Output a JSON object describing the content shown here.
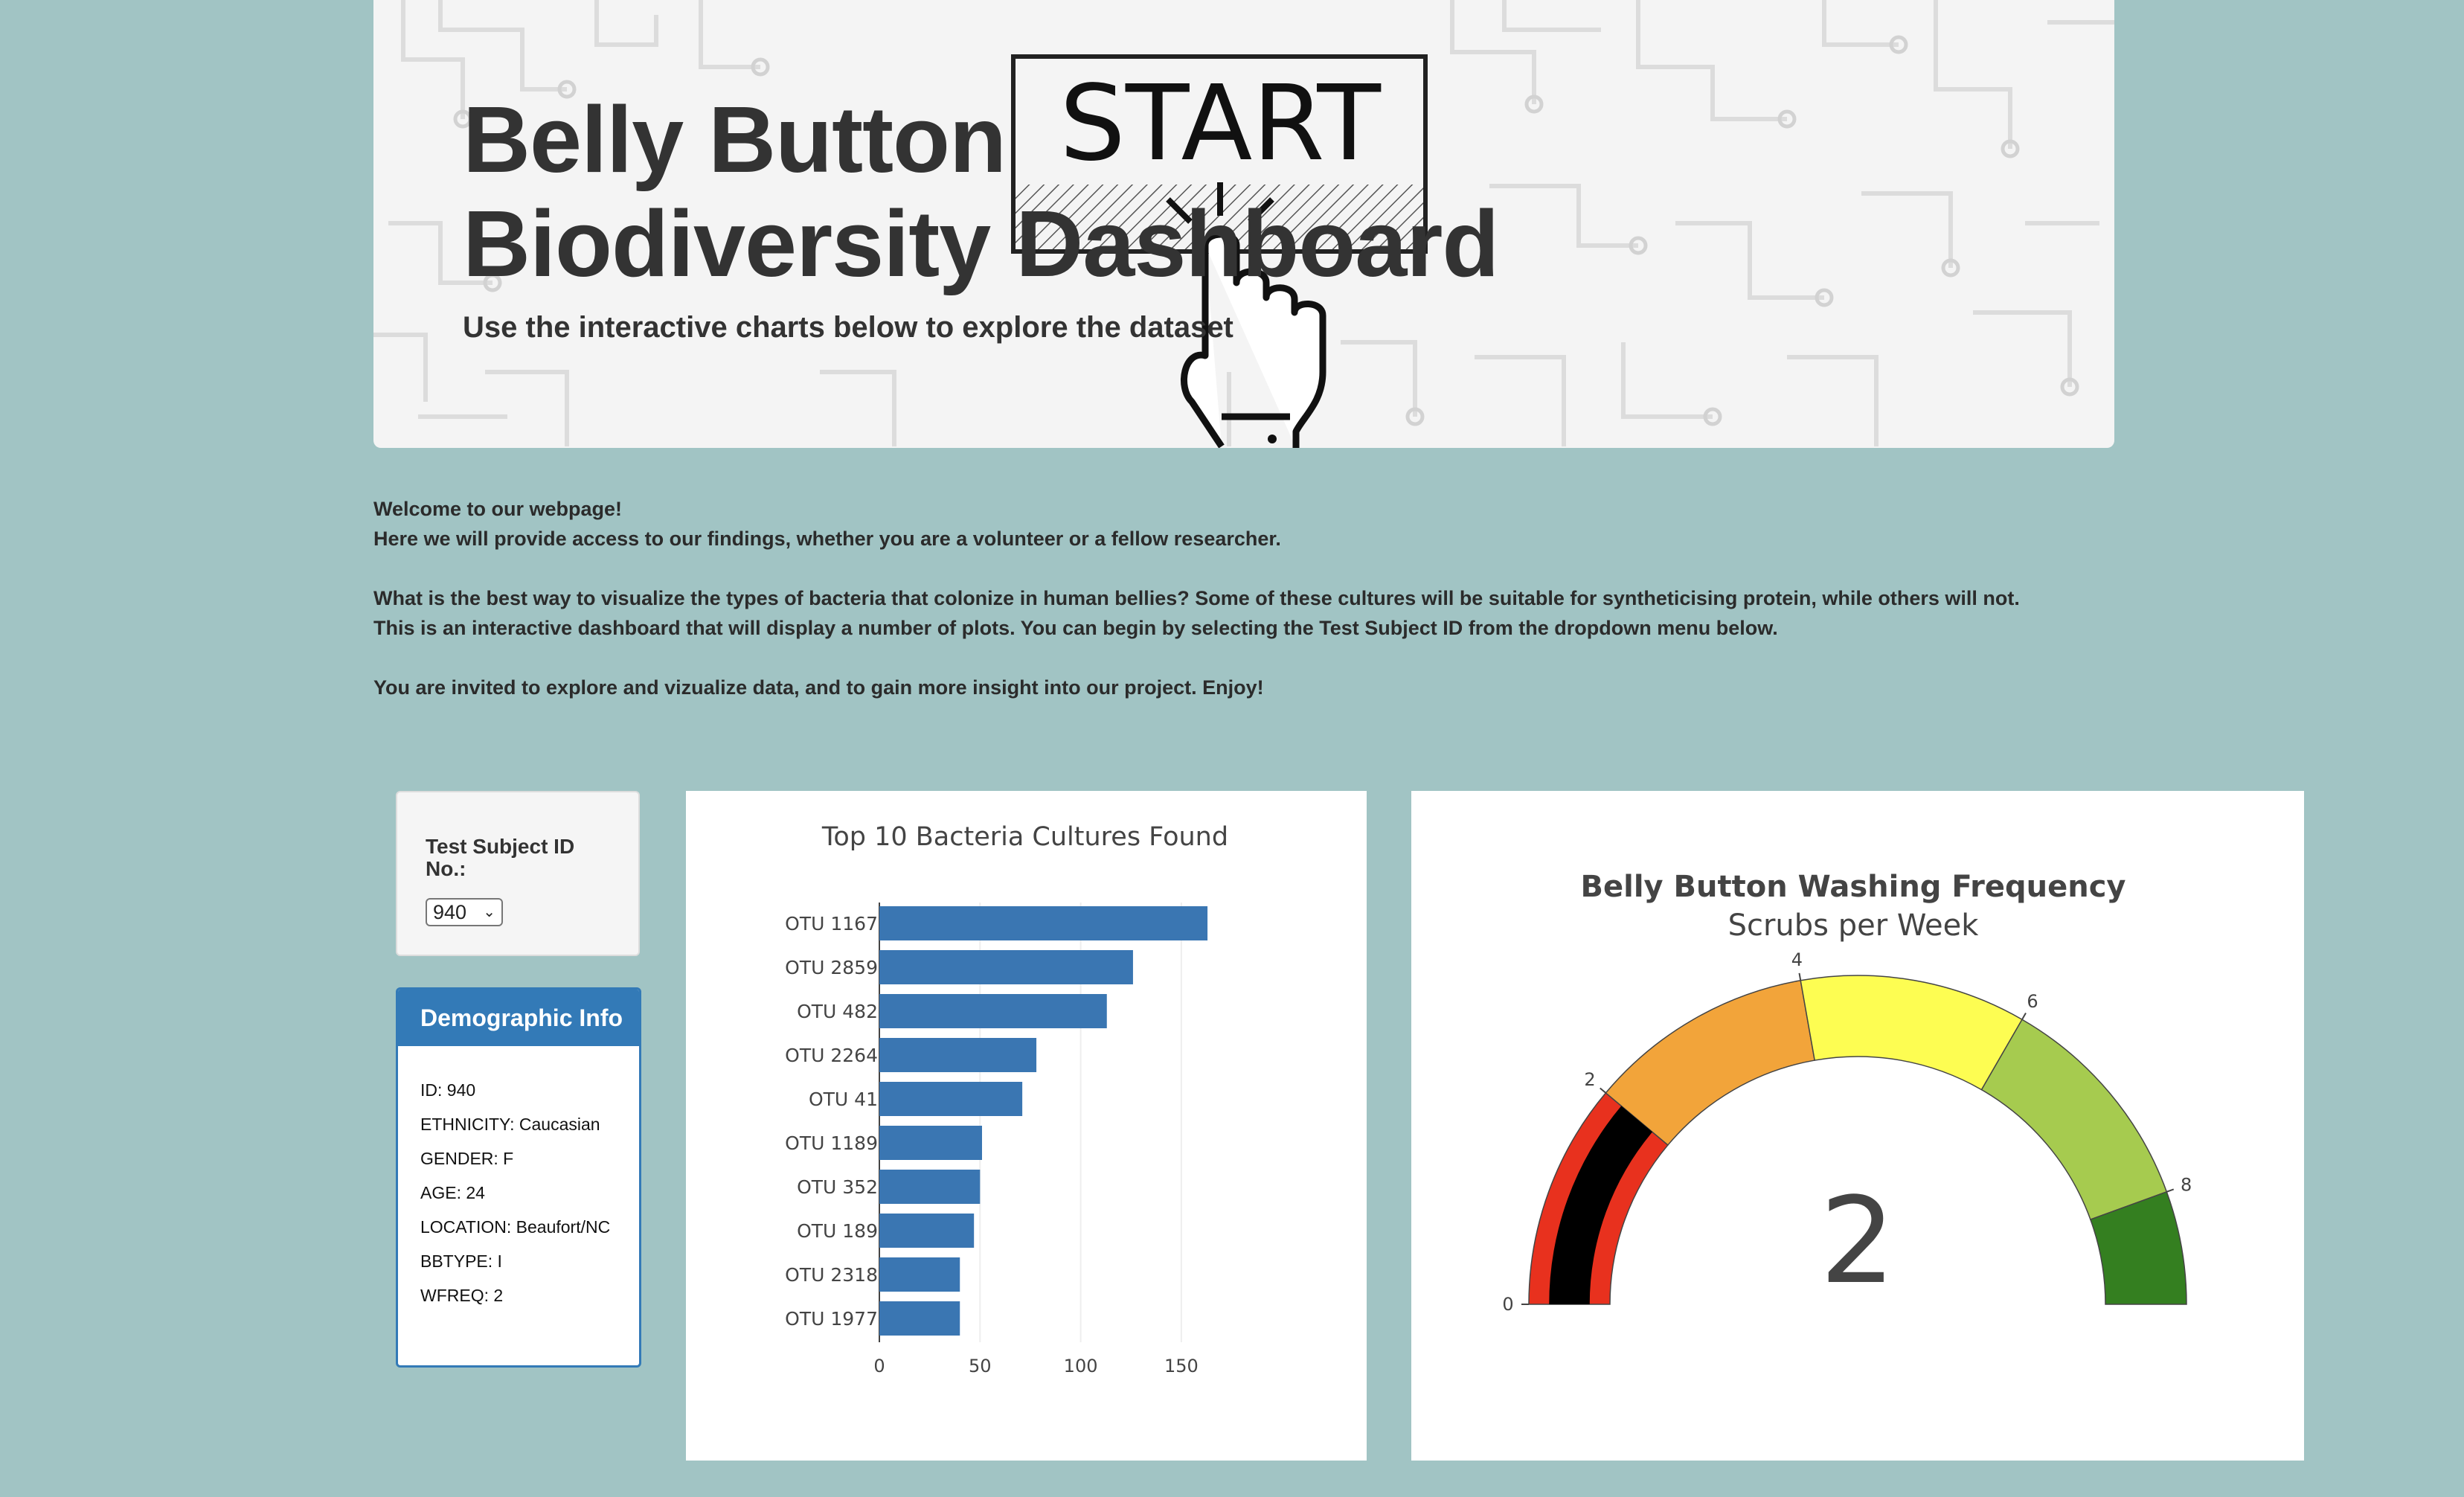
{
  "header": {
    "title_line1": "Belly Button",
    "title_line2": "Biodiversity Dashboard",
    "subtitle": "Use the interactive charts below to explore the dataset",
    "start_art_text": "START"
  },
  "intro": {
    "line1": "Welcome to our webpage!",
    "line2": "Here we will provide access to our findings, whether you are a volunteer or a fellow researcher.",
    "line3": "What is the best way to visualize the types of bacteria that colonize in human bellies? Some of these cultures will be suitable for syntheticising protein, while others will not.",
    "line4": "This is an interactive dashboard that will display a number of plots. You can begin by selecting the Test Subject ID from the dropdown menu below.",
    "line5": "You are invited to explore and vizualize data, and to gain more insight into our project. Enjoy!"
  },
  "selector": {
    "label": "Test Subject ID No.:",
    "selected": "940"
  },
  "demographic": {
    "heading": "Demographic Info",
    "items": [
      "ID: 940",
      "ETHNICITY: Caucasian",
      "GENDER: F",
      "AGE: 24",
      "LOCATION: Beaufort/NC",
      "BBTYPE: I",
      "WFREQ: 2"
    ]
  },
  "chart_data": [
    {
      "type": "bar",
      "orientation": "horizontal",
      "title": "Top 10 Bacteria Cultures Found",
      "categories": [
        "OTU 1167",
        "OTU 2859",
        "OTU 482",
        "OTU 2264",
        "OTU 41",
        "OTU 1189",
        "OTU 352",
        "OTU 189",
        "OTU 2318",
        "OTU 1977"
      ],
      "values": [
        163,
        126,
        113,
        78,
        71,
        51,
        50,
        47,
        40,
        40
      ],
      "xticks": [
        "0",
        "50",
        "100",
        "150"
      ],
      "xlim": [
        0,
        170
      ],
      "color": "#3a76b2",
      "grid": true
    },
    {
      "type": "gauge",
      "title": "Belly Button Washing Frequency",
      "subtitle": "Scrubs per Week",
      "value": 2,
      "value_label": "2",
      "range": [
        0,
        9
      ],
      "ticks": [
        "0",
        "2",
        "4",
        "6",
        "8"
      ],
      "bands": [
        {
          "from": 0,
          "to": 2,
          "color": "#e8311e"
        },
        {
          "from": 2,
          "to": 4,
          "color": "#f2a43a"
        },
        {
          "from": 4,
          "to": 6,
          "color": "#fdfd52"
        },
        {
          "from": 6,
          "to": 8,
          "color": "#a6cb4f"
        },
        {
          "from": 8,
          "to": 9,
          "color": "#347f20"
        }
      ],
      "bar_color": "#000000"
    }
  ]
}
